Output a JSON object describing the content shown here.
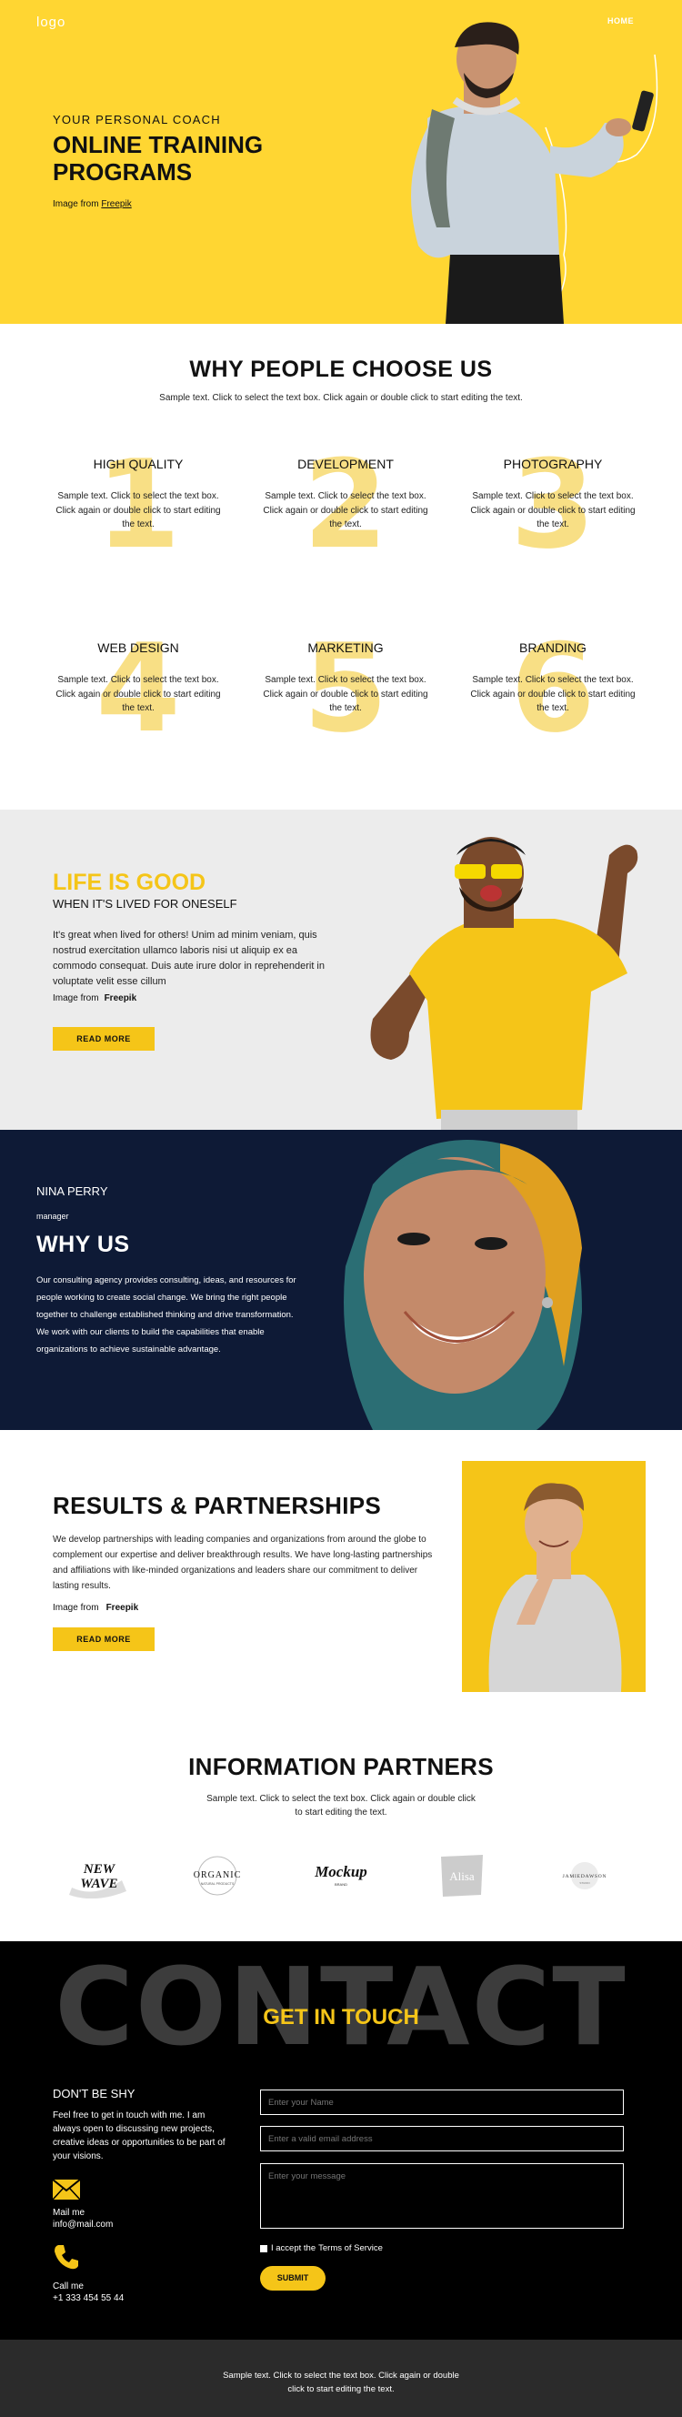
{
  "header": {
    "logo": "logo",
    "nav_home": "HOME"
  },
  "hero": {
    "subtitle": "YOUR PERSONAL COACH",
    "title": "ONLINE TRAINING PROGRAMS",
    "credit_prefix": "Image from",
    "credit_link": "Freepik"
  },
  "why": {
    "title": "WHY PEOPLE CHOOSE US",
    "subtitle": "Sample text. Click to select the text box. Click again or double click to start editing the text.",
    "features": [
      {
        "num": "1",
        "title": "HIGH QUALITY",
        "text": "Sample text. Click to select the text box. Click again or double click to start editing the text."
      },
      {
        "num": "2",
        "title": "DEVELOPMENT",
        "text": "Sample text. Click to select the text box. Click again or double click to start editing the text."
      },
      {
        "num": "3",
        "title": "PHOTOGRAPHY",
        "text": "Sample text. Click to select the text box. Click again or double click to start editing the text."
      },
      {
        "num": "4",
        "title": "WEB DESIGN",
        "text": "Sample text. Click to select the text box. Click again or double click to start editing the text."
      },
      {
        "num": "5",
        "title": "MARKETING",
        "text": "Sample text. Click to select the text box. Click again or double click to start editing the text."
      },
      {
        "num": "6",
        "title": "BRANDING",
        "text": "Sample text. Click to select the text box. Click again or double click to start editing the text."
      }
    ]
  },
  "life": {
    "title": "LIFE IS GOOD",
    "subtitle": "WHEN IT'S LIVED FOR ONESELF",
    "text": "It's great when lived for others! Unim ad minim veniam, quis nostrud exercitation ullamco laboris nisi ut aliquip ex ea commodo consequat. Duis aute irure dolor in reprehenderit in voluptate velit esse cillum",
    "credit_prefix": "Image from",
    "credit_link": "Freepik",
    "button": "READ MORE"
  },
  "nina": {
    "name": "NINA PERRY",
    "role": "manager",
    "title": "WHY US",
    "text": "Our consulting agency provides consulting, ideas, and resources for people working to create social change. We bring the right people together to challenge established thinking and drive transformation. We work with our clients to build the capabilities that enable organizations to achieve sustainable advantage."
  },
  "results": {
    "title": "RESULTS & PARTNERSHIPS",
    "text": "We develop partnerships with leading companies and organizations from around the globe to complement our expertise and deliver breakthrough results. We have long-lasting partnerships and affiliations with like-minded organizations and leaders share our commitment to deliver lasting results.",
    "credit_prefix": "Image from",
    "credit_link": "Freepik",
    "button": "READ MORE"
  },
  "partners": {
    "title": "INFORMATION PARTNERS",
    "subtitle": "Sample text. Click to select the text box. Click again or double click to start editing the text.",
    "logos": [
      {
        "line1": "NEW",
        "line2": "WAVE"
      },
      {
        "line1": "ORGANIC",
        "line2": "NATURAL PRODUCTS"
      },
      {
        "line1": "Mockup",
        "line2": "BRAND"
      },
      {
        "line1": "Alisa",
        "line2": ""
      },
      {
        "line1": "JAMIEDAWSON",
        "line2": "STUDIO"
      }
    ]
  },
  "contact": {
    "bg_word": "CONTACT",
    "title": "GET IN TOUCH",
    "shy_title": "DON'T BE SHY",
    "shy_text": "Feel free to get in touch with me. I am always open to discussing new projects, creative ideas or opportunities to be part of your visions.",
    "mail_label": "Mail me",
    "mail_value": "info@mail.com",
    "call_label": "Call me",
    "call_value": "+1 333 454 55 44",
    "name_placeholder": "Enter your Name",
    "email_placeholder": "Enter a valid email address",
    "message_placeholder": "Enter your message",
    "accept_prefix": "I accept the",
    "accept_link": "Terms of Service",
    "submit": "SUBMIT"
  },
  "footer": {
    "text": "Sample text. Click to select the text box. Click again or double click to start editing the text."
  },
  "colors": {
    "accent": "#f5c518",
    "hero_bg": "#ffd632",
    "dark_bg": "#0e1a36",
    "contact_bg": "#000000",
    "footer_bg": "#2b2b2b"
  }
}
